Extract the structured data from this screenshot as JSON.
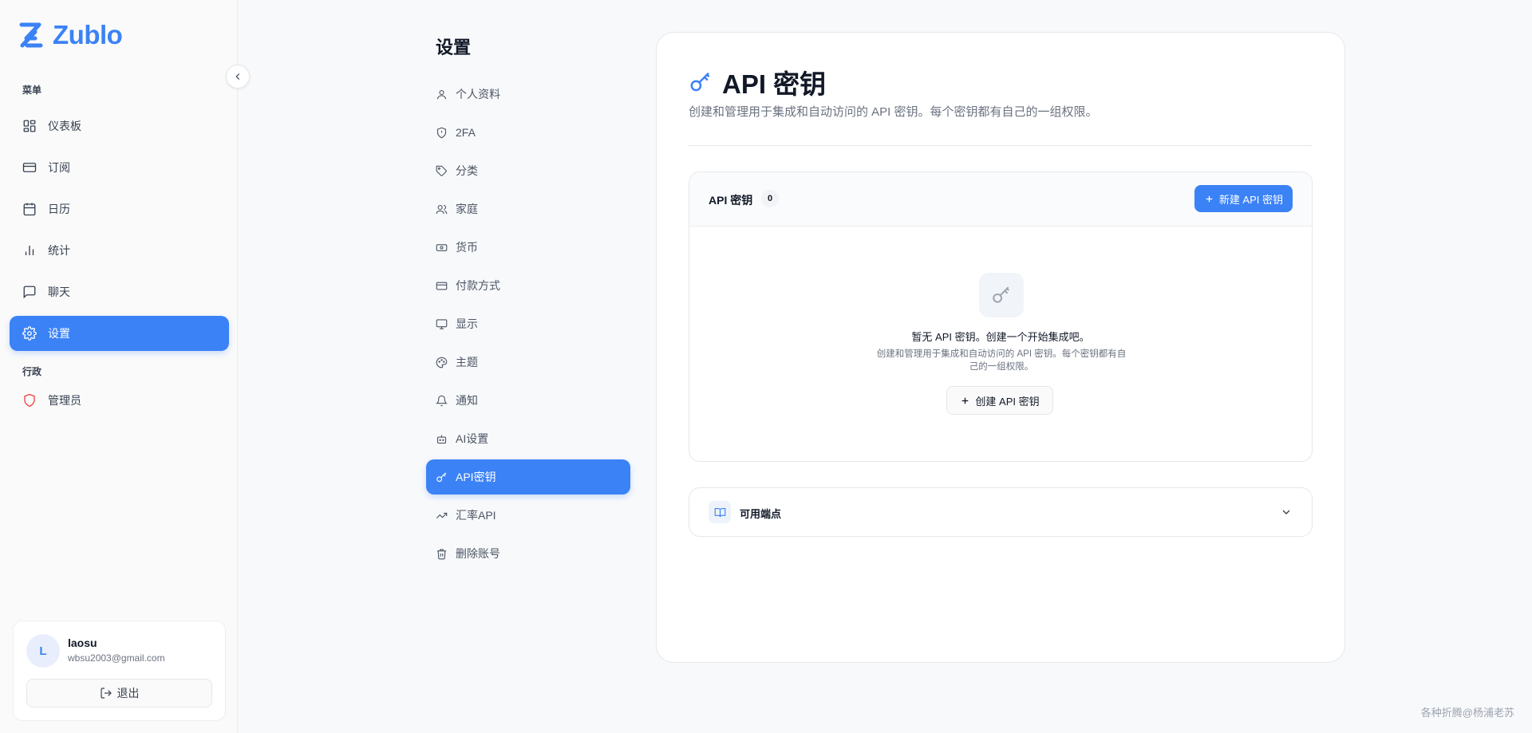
{
  "app": {
    "name": "Zublo",
    "brand_color": "#3b82f6"
  },
  "sidebar": {
    "menu_section": "菜单",
    "items": [
      {
        "label": "仪表板",
        "icon": "dashboard-icon"
      },
      {
        "label": "订阅",
        "icon": "credit-card-icon"
      },
      {
        "label": "日历",
        "icon": "calendar-icon"
      },
      {
        "label": "统计",
        "icon": "bar-chart-icon"
      },
      {
        "label": "聊天",
        "icon": "chat-icon"
      },
      {
        "label": "设置",
        "icon": "gear-icon",
        "active": true
      }
    ],
    "admin_section": "行政",
    "admin_items": [
      {
        "label": "管理员",
        "icon": "shield-icon",
        "color": "#ef4444"
      }
    ]
  },
  "user": {
    "initial": "L",
    "name": "laosu",
    "email": "wbsu2003@gmail.com",
    "logout_label": "退出"
  },
  "settings_nav": {
    "title": "设置",
    "items": [
      {
        "label": "个人资料",
        "icon": "user-icon"
      },
      {
        "label": "2FA",
        "icon": "shield-check-icon"
      },
      {
        "label": "分类",
        "icon": "tag-icon"
      },
      {
        "label": "家庭",
        "icon": "users-icon"
      },
      {
        "label": "货币",
        "icon": "banknote-icon"
      },
      {
        "label": "付款方式",
        "icon": "credit-card-icon"
      },
      {
        "label": "显示",
        "icon": "monitor-icon"
      },
      {
        "label": "主题",
        "icon": "palette-icon"
      },
      {
        "label": "通知",
        "icon": "bell-icon"
      },
      {
        "label": "AI设置",
        "icon": "bot-icon"
      },
      {
        "label": "API密钥",
        "icon": "key-icon",
        "active": true
      },
      {
        "label": "汇率API",
        "icon": "trending-up-icon"
      },
      {
        "label": "删除账号",
        "icon": "trash-icon"
      }
    ]
  },
  "main": {
    "title": "API 密钥",
    "description": "创建和管理用于集成和自动访问的 API 密钥。每个密钥都有自己的一组权限。",
    "keys_panel": {
      "label": "API 密钥",
      "count": "0",
      "new_button": "新建 API 密钥",
      "empty_title": "暂无 API 密钥。创建一个开始集成吧。",
      "empty_desc": "创建和管理用于集成和自动访问的 API 密钥。每个密钥都有自己的一组权限。",
      "create_button": "创建 API 密钥"
    },
    "endpoints": {
      "label": "可用端点"
    }
  },
  "watermark": "各种折腾@杨浦老苏"
}
